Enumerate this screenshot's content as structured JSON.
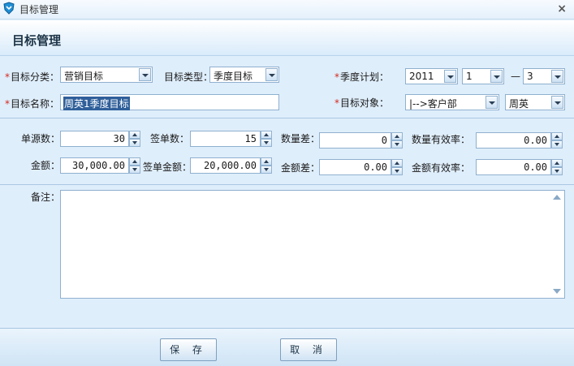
{
  "window": {
    "title": "目标管理",
    "close": "×"
  },
  "header": {
    "title": "目标管理"
  },
  "colors": {
    "required": "#d42a1f",
    "background": "#dfeefb",
    "accent": "#2f5f9a"
  },
  "icons": {
    "app": "shield-app-icon",
    "close": "close-icon"
  },
  "form": {
    "required_mark": "*",
    "category": {
      "label": "目标分类：",
      "value": "营销目标"
    },
    "type": {
      "label": "目标类型：",
      "value": "季度目标"
    },
    "quarter_plan": {
      "label": "季度计划：",
      "year": "2011",
      "from": "1",
      "dash": "—",
      "to": "3"
    },
    "target_name": {
      "label": "目标名称：",
      "value": "周英1季度目标"
    },
    "target_object": {
      "label": "目标对象：",
      "department": "|-->客户部",
      "person": "周英"
    },
    "metrics": {
      "source_count": {
        "label": "单源数：",
        "value": "30"
      },
      "signed_count": {
        "label": "签单数：",
        "value": "15"
      },
      "count_diff": {
        "label": "数量差：",
        "value": "0"
      },
      "count_efficiency": {
        "label": "数量有效率：",
        "value": "0.00"
      },
      "amount": {
        "label": "金额：",
        "value": "30,000.00"
      },
      "signed_amount": {
        "label": "签单金额：",
        "value": "20,000.00"
      },
      "amount_diff": {
        "label": "金额差：",
        "value": "0.00"
      },
      "amount_efficiency": {
        "label": "金额有效率：",
        "value": "0.00"
      }
    },
    "remarks": {
      "label": "备注：",
      "value": ""
    }
  },
  "buttons": {
    "save": "保 存",
    "cancel": "取 消"
  }
}
